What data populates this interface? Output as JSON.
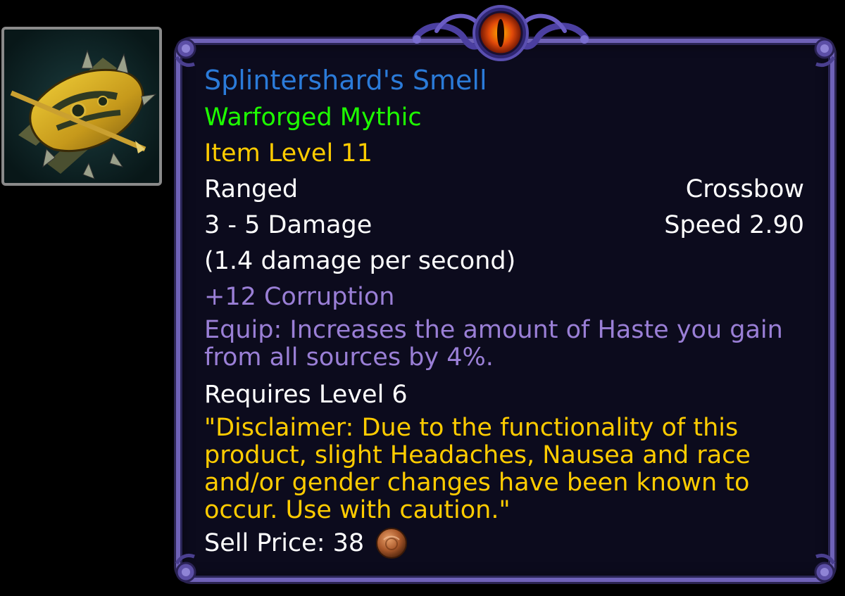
{
  "item": {
    "name": "Splintershard's Smell",
    "quality": "Warforged Mythic",
    "item_level": "Item Level 11",
    "slot": "Ranged",
    "type": "Crossbow",
    "damage": "3 - 5 Damage",
    "speed": "Speed 2.90",
    "dps": "(1.4 damage per second)",
    "corruption": "+12 Corruption",
    "equip": "Equip: Increases the amount of Haste you gain from all sources by 4%.",
    "requires": "Requires Level 6",
    "flavor": "\"Disclaimer: Due to the functionality of this product, slight Headaches, Nausea and race and/or gender changes have been known to occur. Use with caution.\"",
    "sell_label": "Sell Price: 38",
    "sell_currency_icon": "copper-coin-icon",
    "icon": "crossbow-icon"
  },
  "colors": {
    "name": "#2b7bd9",
    "quality": "#1eff00",
    "item_level": "#ffcc00",
    "corruption": "#9a7fd6",
    "flavor": "#ffcc00",
    "border": "#6f62b8",
    "background": "#0c0b1d"
  }
}
